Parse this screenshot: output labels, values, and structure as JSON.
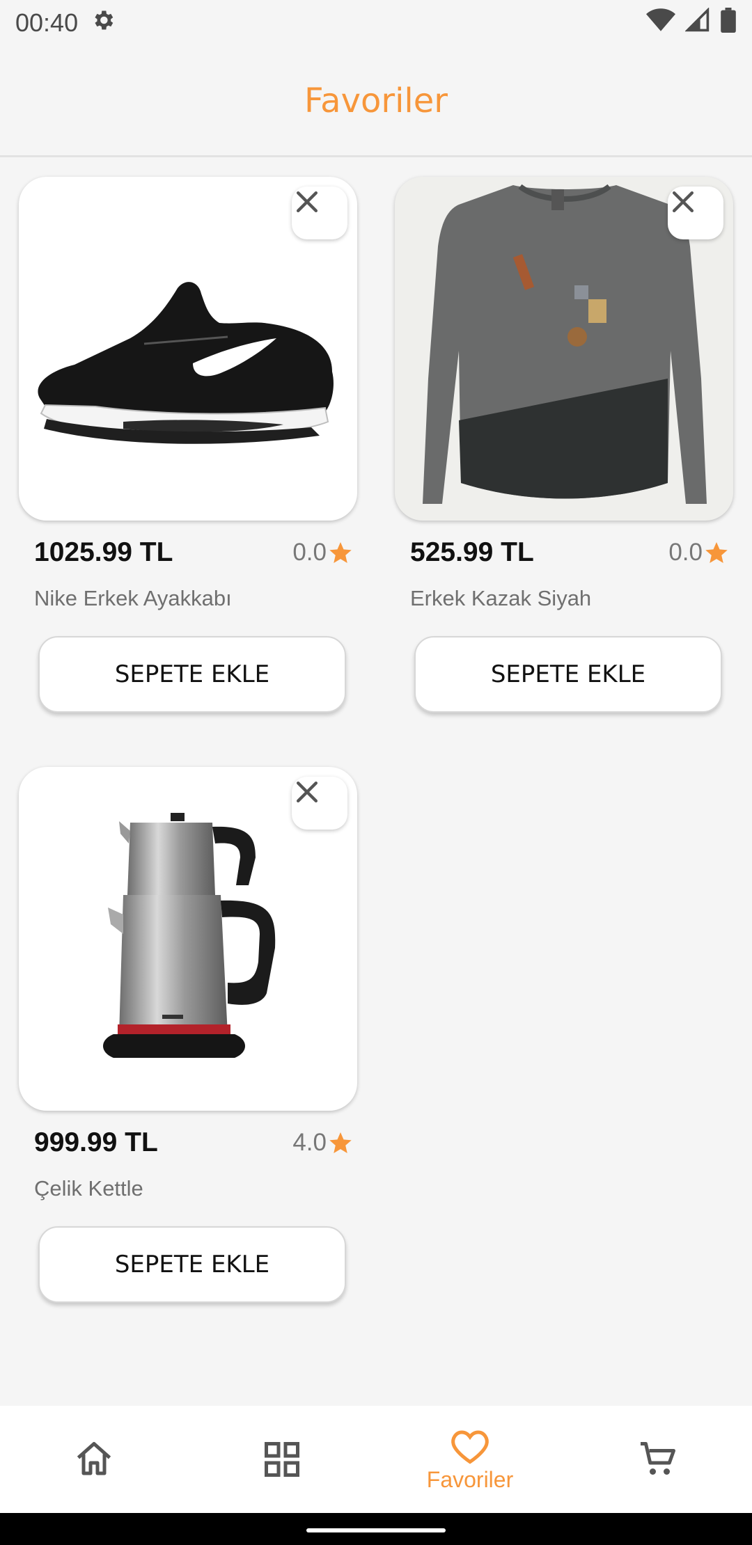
{
  "status_bar": {
    "time": "00:40"
  },
  "app_bar": {
    "title": "Favoriler"
  },
  "products": [
    {
      "price": "1025.99 TL",
      "rating": "0.0",
      "name": "Nike Erkek Ayakkabı",
      "add_label": "SEPETE EKLE",
      "image_icon": "sneaker-image"
    },
    {
      "price": "525.99 TL",
      "rating": "0.0",
      "name": "Erkek Kazak Siyah",
      "add_label": "SEPETE EKLE",
      "image_icon": "sweater-image"
    },
    {
      "price": "999.99 TL",
      "rating": "4.0",
      "name": "Çelik Kettle",
      "add_label": "SEPETE EKLE",
      "image_icon": "kettle-image"
    }
  ],
  "bottom_nav": {
    "items": [
      {
        "icon": "home-icon",
        "label": ""
      },
      {
        "icon": "grid-icon",
        "label": ""
      },
      {
        "icon": "heart-icon",
        "label": "Favoriler"
      },
      {
        "icon": "cart-icon",
        "label": ""
      }
    ]
  },
  "colors": {
    "accent": "#f7963a",
    "background": "#f5f5f5"
  }
}
